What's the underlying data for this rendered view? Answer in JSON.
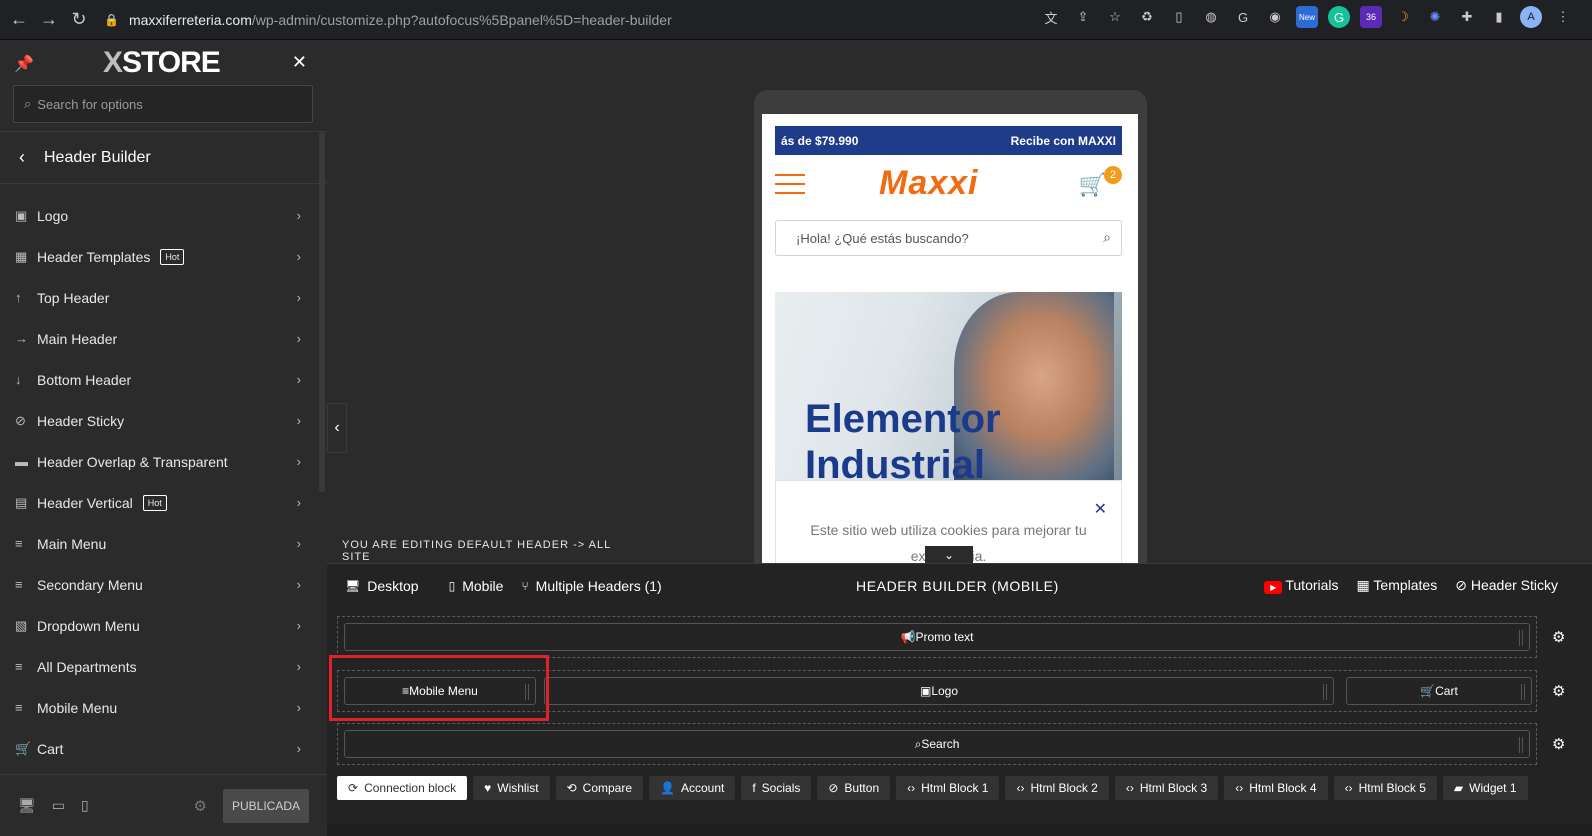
{
  "browser": {
    "url_host": "maxxiferreteria.com",
    "url_path": "/wp-admin/customize.php?autofocus%5Bpanel%5D=header-builder",
    "ext_badge_new": "New",
    "ext_badge_count": "36",
    "avatar_letter": "A"
  },
  "sidebar": {
    "brand_x": "X",
    "brand_rest": "STORE",
    "search_placeholder": "Search for options",
    "panel_title": "Header Builder",
    "items": [
      {
        "label": "Logo",
        "icon": "image-icon"
      },
      {
        "label": "Header Templates",
        "icon": "grid-icon",
        "badge": "Hot"
      },
      {
        "label": "Top Header",
        "icon": "arrow-up-icon"
      },
      {
        "label": "Main Header",
        "icon": "arrow-right-icon"
      },
      {
        "label": "Bottom Header",
        "icon": "arrow-down-icon"
      },
      {
        "label": "Header Sticky",
        "icon": "clip-icon"
      },
      {
        "label": "Header Overlap & Transparent",
        "icon": "layers-icon"
      },
      {
        "label": "Header Vertical",
        "icon": "document-icon",
        "badge": "Hot"
      },
      {
        "label": "Main Menu",
        "icon": "menu-icon"
      },
      {
        "label": "Secondary Menu",
        "icon": "menu-icon"
      },
      {
        "label": "Dropdown Menu",
        "icon": "dropdown-icon"
      },
      {
        "label": "All Departments",
        "icon": "menu-icon"
      },
      {
        "label": "Mobile Menu",
        "icon": "menu-icon"
      },
      {
        "label": "Cart",
        "icon": "cart-icon"
      }
    ],
    "publish_label": "PUBLICADA"
  },
  "preview": {
    "promo_left": "ás de $79.990",
    "promo_right": "Recibe con MAXXI",
    "logo_text": "Maxxi",
    "cart_count": "2",
    "search_placeholder": "¡Hola! ¿Qué estás buscando?",
    "hero_title_line1": "Elementor",
    "hero_title_line2": "Industrial",
    "cookie_text": "Este sitio web utiliza cookies para mejorar tu experiencia."
  },
  "builder": {
    "editing_banner": "YOU ARE EDITING DEFAULT HEADER -> ALL SITE",
    "tab_desktop": "Desktop",
    "tab_mobile": "Mobile",
    "tab_multiple": "Multiple Headers (1)",
    "title": "HEADER BUILDER (MOBILE)",
    "tutorials": "Tutorials",
    "templates": "Templates",
    "header_sticky": "Header Sticky",
    "row1": "Promo text",
    "row2_left": "Mobile Menu",
    "row2_center": "Logo",
    "row2_right": "Cart",
    "row3": "Search",
    "chips": [
      {
        "label": "Connection block",
        "icon": "link-icon"
      },
      {
        "label": "Wishlist",
        "icon": "heart-icon"
      },
      {
        "label": "Compare",
        "icon": "compare-icon"
      },
      {
        "label": "Account",
        "icon": "user-icon"
      },
      {
        "label": "Socials",
        "icon": "social-icon"
      },
      {
        "label": "Button",
        "icon": "button-icon"
      },
      {
        "label": "Html Block 1",
        "icon": "code-icon"
      },
      {
        "label": "Html Block 2",
        "icon": "code-icon"
      },
      {
        "label": "Html Block 3",
        "icon": "code-icon"
      },
      {
        "label": "Html Block 4",
        "icon": "code-icon"
      },
      {
        "label": "Html Block 5",
        "icon": "code-icon"
      },
      {
        "label": "Widget 1",
        "icon": "widget-icon"
      }
    ]
  },
  "colors": {
    "accent_orange": "#f36a10",
    "brand_blue": "#1f3c8a",
    "highlight_red": "#e0202a"
  }
}
